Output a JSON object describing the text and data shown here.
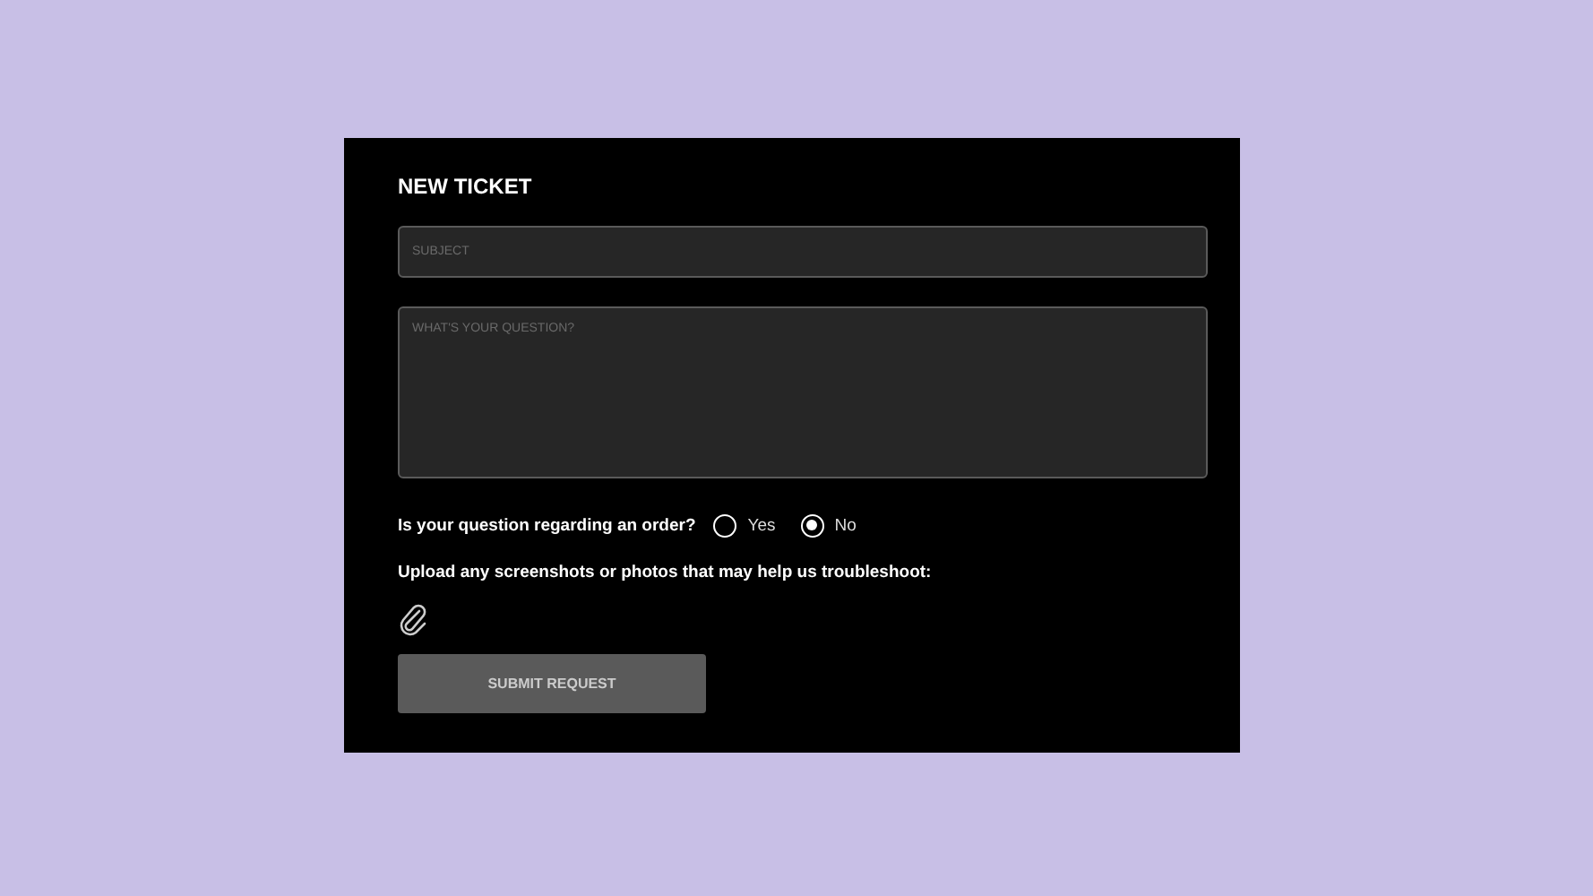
{
  "form": {
    "title": "NEW TICKET",
    "subject": {
      "placeholder": "SUBJECT"
    },
    "question": {
      "placeholder": "WHAT'S YOUR QUESTION?"
    },
    "order_question": {
      "label": "Is your question regarding an order?",
      "options": [
        {
          "label": "Yes",
          "selected": false
        },
        {
          "label": "No",
          "selected": true
        }
      ]
    },
    "upload_label": "Upload any screenshots or photos that may help us troubleshoot:",
    "submit": {
      "label": "SUBMIT REQUEST",
      "disabled": true
    }
  }
}
